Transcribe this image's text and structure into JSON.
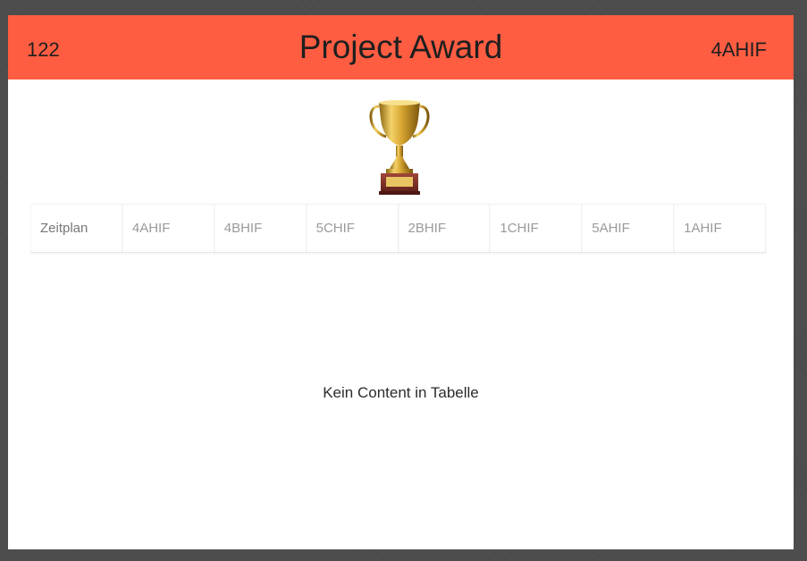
{
  "header": {
    "left_text": "122",
    "title": "Project Award",
    "right_text": "4AHIF",
    "background_color": "#ff5d42"
  },
  "logo": {
    "icon": "trophy-icon"
  },
  "tabs": [
    {
      "label": "Zeitplan"
    },
    {
      "label": "4AHIF"
    },
    {
      "label": "4BHIF"
    },
    {
      "label": "5CHIF"
    },
    {
      "label": "2BHIF"
    },
    {
      "label": "1CHIF"
    },
    {
      "label": "5AHIF"
    },
    {
      "label": "1AHIF"
    }
  ],
  "content": {
    "empty_message": "Kein Content in Tabelle"
  }
}
